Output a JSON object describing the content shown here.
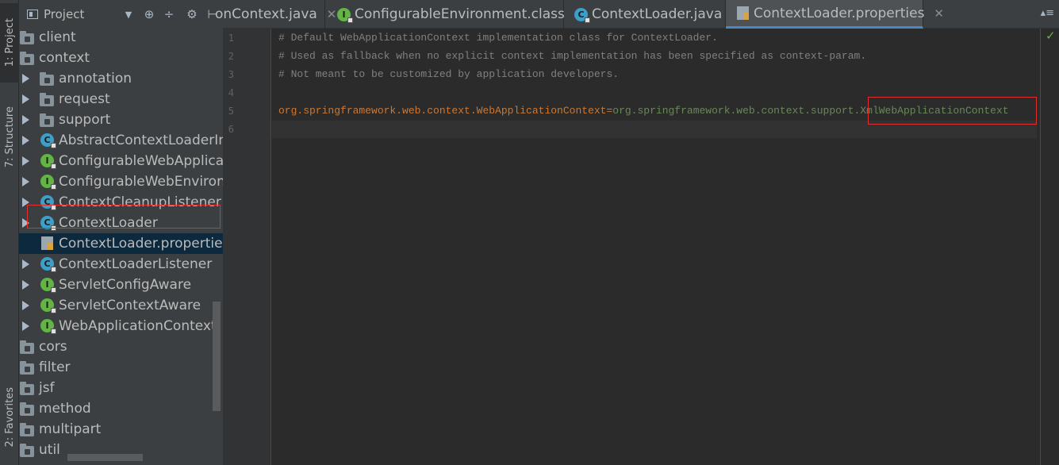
{
  "left_strip": {
    "project_tab": "1: Project",
    "structure_tab": "7: Structure",
    "favorites_tab": "2: Favorites"
  },
  "project_panel": {
    "title": "Project",
    "toolbar": {
      "dropdown": "▼",
      "target": "⊕",
      "collapse": "÷",
      "settings": "⚙",
      "hide": "⊢"
    },
    "tree": [
      {
        "label": "client",
        "type": "folder",
        "indent": 0
      },
      {
        "label": "context",
        "type": "folder",
        "indent": 0
      },
      {
        "label": "annotation",
        "type": "folder",
        "indent": 1
      },
      {
        "label": "request",
        "type": "folder",
        "indent": 1
      },
      {
        "label": "support",
        "type": "folder",
        "indent": 1
      },
      {
        "label": "AbstractContextLoaderInitia",
        "type": "class",
        "indent": 1
      },
      {
        "label": "ConfigurableWebApplicatio",
        "type": "interface",
        "indent": 1
      },
      {
        "label": "ConfigurableWebEnvironm",
        "type": "interface",
        "indent": 1
      },
      {
        "label": "ContextCleanupListener",
        "type": "class",
        "indent": 1
      },
      {
        "label": "ContextLoader",
        "type": "class",
        "indent": 1
      },
      {
        "label": "ContextLoader.properties",
        "type": "properties",
        "indent": 1,
        "selected": true
      },
      {
        "label": "ContextLoaderListener",
        "type": "class",
        "indent": 1
      },
      {
        "label": "ServletConfigAware",
        "type": "interface",
        "indent": 1
      },
      {
        "label": "ServletContextAware",
        "type": "interface",
        "indent": 1
      },
      {
        "label": "WebApplicationContext",
        "type": "interface",
        "indent": 1
      },
      {
        "label": "cors",
        "type": "folder",
        "indent": 0
      },
      {
        "label": "filter",
        "type": "folder",
        "indent": 0
      },
      {
        "label": "jsf",
        "type": "folder",
        "indent": 0
      },
      {
        "label": "method",
        "type": "folder",
        "indent": 0
      },
      {
        "label": "multipart",
        "type": "folder",
        "indent": 0
      },
      {
        "label": "util",
        "type": "folder",
        "indent": 0
      }
    ]
  },
  "tabs": [
    {
      "label": "onContext.java",
      "icon": "class",
      "active": false
    },
    {
      "label": "ConfigurableEnvironment.class",
      "icon": "interface",
      "active": false
    },
    {
      "label": "ContextLoader.java",
      "icon": "class",
      "active": false
    },
    {
      "label": "ContextLoader.properties",
      "icon": "properties",
      "active": true
    }
  ],
  "tab_close": "✕",
  "tab_menu": "▴≡",
  "editor": {
    "line_numbers": [
      "1",
      "2",
      "3",
      "4",
      "5",
      "6"
    ],
    "comment1": "# Default WebApplicationContext implementation class for ContextLoader.",
    "comment2": "# Used as fallback when no explicit context implementation has been specified as context-param.",
    "comment3": "# Not meant to be customized by application developers.",
    "key": "org.springframework.web.context.WebApplicationContext",
    "eq": "=",
    "value_prefix": "org.springframework.web.context.support.",
    "value_highlight": "XmlWebApplicationContext"
  },
  "status_check": "✓",
  "colors": {
    "highlight_border": "#e12f2f",
    "class_icon": "#3d9fc8",
    "interface_icon": "#62b543",
    "selection": "#0d293e"
  }
}
